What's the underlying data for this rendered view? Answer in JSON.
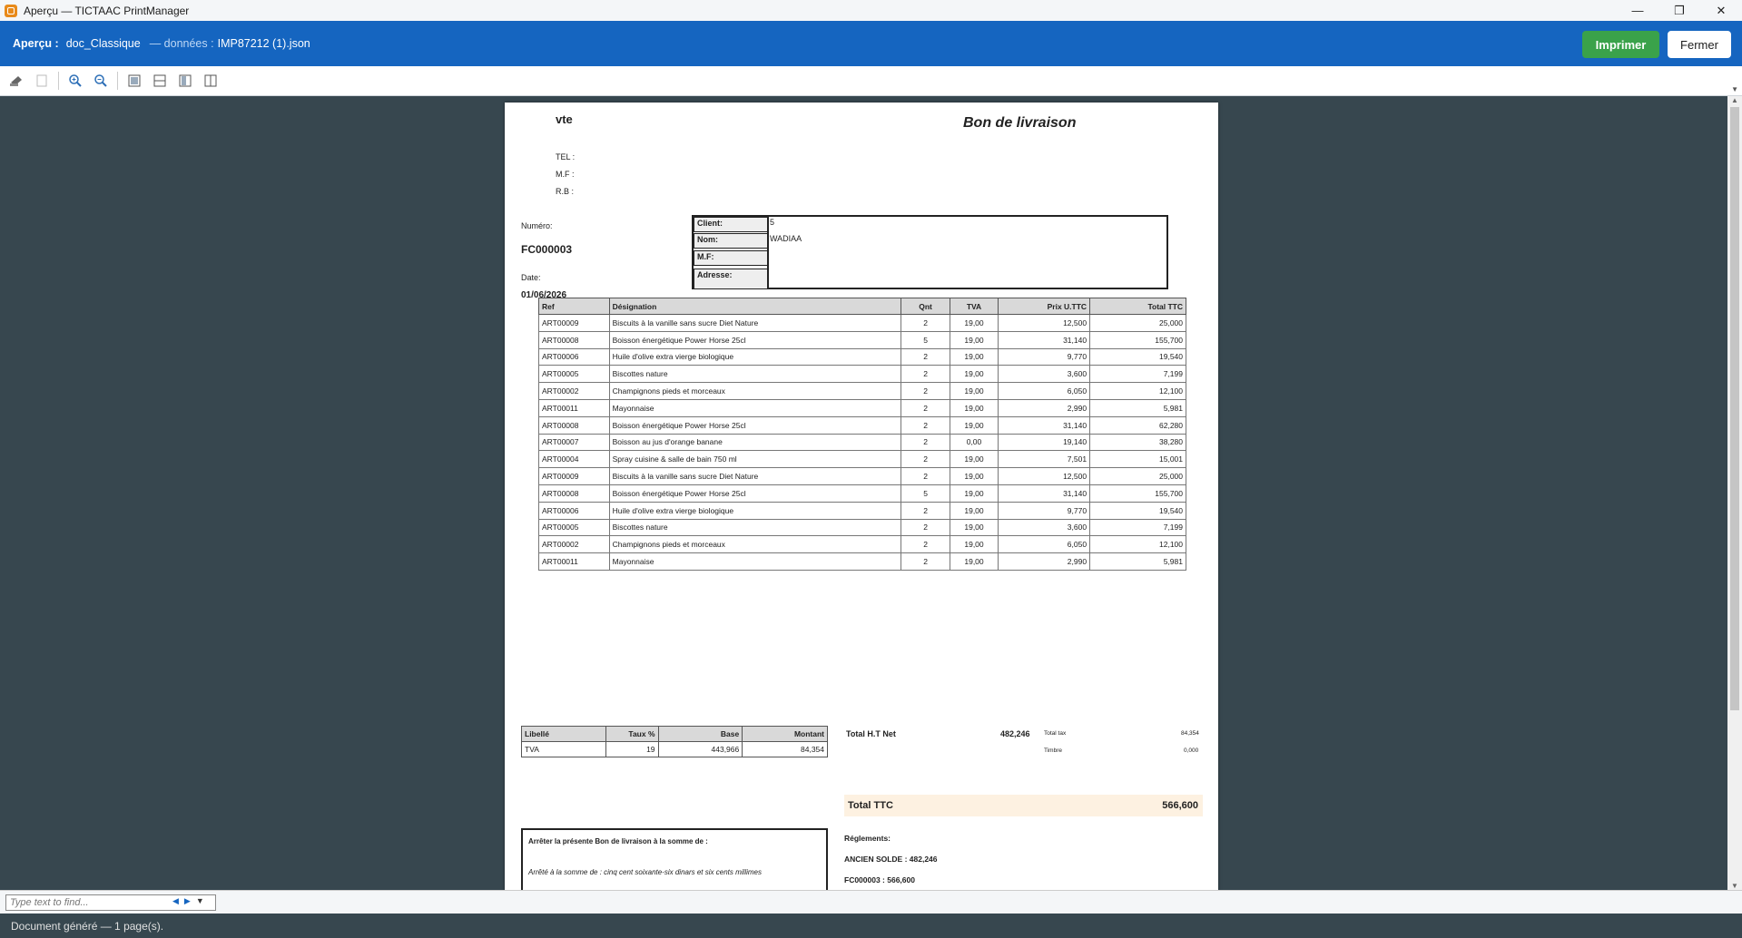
{
  "window": {
    "title": "Aperçu — TICTAAC PrintManager",
    "minimize": "—",
    "maximize": "❐",
    "close": "✕"
  },
  "header": {
    "label": "Aperçu :",
    "doc": "doc_Classique",
    "data_label": "— données :",
    "file": "IMP87212 (1).json",
    "print": "Imprimer",
    "close": "Fermer"
  },
  "document": {
    "company": "vte",
    "title": "Bon de livraison",
    "company_lines": [
      "TEL :",
      "M.F :",
      "R.B :"
    ],
    "numero_label": "Numéro:",
    "numero": "FC000003",
    "date_label": "Date:",
    "date": "01/06/2026",
    "client": {
      "client_label": "Client:",
      "client_val": "5",
      "nom_label": "Nom:",
      "nom_val": "WADIAA",
      "mf_label": "M.F:",
      "adresse_label": "Adresse:"
    },
    "columns": [
      "Ref",
      "Désignation",
      "Qnt",
      "TVA",
      "Prix U.TTC",
      "Total TTC"
    ],
    "rows": [
      [
        "ART00009",
        "Biscuits à la vanille sans sucre Diet Nature",
        "2",
        "19,00",
        "12,500",
        "25,000"
      ],
      [
        "ART00008",
        "Boisson énergétique Power Horse 25cl",
        "5",
        "19,00",
        "31,140",
        "155,700"
      ],
      [
        "ART00006",
        "Huile d'olive extra vierge biologique",
        "2",
        "19,00",
        "9,770",
        "19,540"
      ],
      [
        "ART00005",
        "Biscottes nature",
        "2",
        "19,00",
        "3,600",
        "7,199"
      ],
      [
        "ART00002",
        "Champignons pieds et morceaux",
        "2",
        "19,00",
        "6,050",
        "12,100"
      ],
      [
        "ART00011",
        "Mayonnaise",
        "2",
        "19,00",
        "2,990",
        "5,981"
      ],
      [
        "ART00008",
        "Boisson énergétique Power Horse 25cl",
        "2",
        "19,00",
        "31,140",
        "62,280"
      ],
      [
        "ART00007",
        "Boisson au jus d'orange banane",
        "2",
        "0,00",
        "19,140",
        "38,280"
      ],
      [
        "ART00004",
        "Spray cuisine & salle de bain 750 ml",
        "2",
        "19,00",
        "7,501",
        "15,001"
      ],
      [
        "ART00009",
        "Biscuits à la vanille sans sucre Diet Nature",
        "2",
        "19,00",
        "12,500",
        "25,000"
      ],
      [
        "ART00008",
        "Boisson énergétique Power Horse 25cl",
        "5",
        "19,00",
        "31,140",
        "155,700"
      ],
      [
        "ART00006",
        "Huile d'olive extra vierge biologique",
        "2",
        "19,00",
        "9,770",
        "19,540"
      ],
      [
        "ART00005",
        "Biscottes nature",
        "2",
        "19,00",
        "3,600",
        "7,199"
      ],
      [
        "ART00002",
        "Champignons pieds et morceaux",
        "2",
        "19,00",
        "6,050",
        "12,100"
      ],
      [
        "ART00011",
        "Mayonnaise",
        "2",
        "19,00",
        "2,990",
        "5,981"
      ]
    ],
    "tva_table": {
      "columns": [
        "Libellé",
        "Taux %",
        "Base",
        "Montant"
      ],
      "row": [
        "TVA",
        "19",
        "443,966",
        "84,354"
      ]
    },
    "totals": {
      "ht_label": "Total H.T Net",
      "ht_val": "482,246",
      "tax_label": "Total tax",
      "tax_val": "84,354",
      "timbre_label": "Timbre",
      "timbre_val": "0,000",
      "ttc_label": "Total TTC",
      "ttc_val": "566,600"
    },
    "arret": {
      "title": "Arrêter la présente Bon de livraison à la somme de :",
      "text": "Arrêté à la somme de : cinq cent soixante-six dinars et six cents millimes"
    },
    "reglements": {
      "label": "Réglements:",
      "ancien": "ANCIEN SOLDE : 482,246",
      "fc": "FC000003 : 566,600"
    }
  },
  "find": {
    "placeholder": "Type text to find..."
  },
  "status": {
    "text": "Document généré — 1 page(s)."
  }
}
